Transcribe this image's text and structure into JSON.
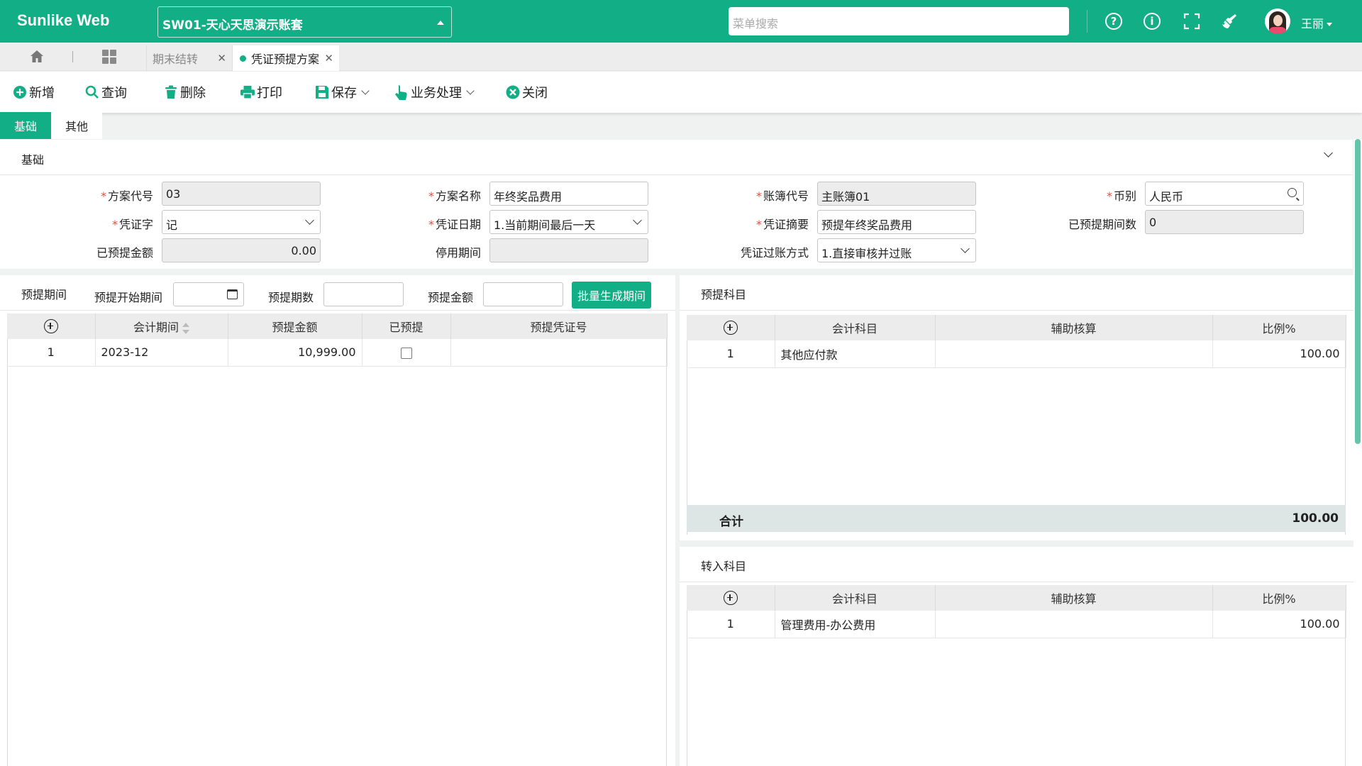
{
  "header": {
    "brand": "Sunlike Web",
    "account_select": "SW01-天心天思演示账套",
    "menu_search_placeholder": "菜单搜索",
    "user_name": "王丽",
    "icons": [
      "help-icon",
      "info-icon",
      "fullscreen-icon",
      "clean-icon"
    ],
    "accent": "#12ae86"
  },
  "tabs": [
    {
      "label": "期末结转",
      "active": false
    },
    {
      "label": "凭证预提方案",
      "active": true
    }
  ],
  "toolbar": {
    "new": "新增",
    "query": "查询",
    "delete": "删除",
    "print": "打印",
    "save": "保存",
    "business": "业务处理",
    "close": "关闭"
  },
  "subtabs": {
    "basic": "基础",
    "other": "其他"
  },
  "basic": {
    "title": "基础",
    "fields": {
      "plan_code": {
        "label": "方案代号",
        "value": "03"
      },
      "plan_name": {
        "label": "方案名称",
        "value": "年终奖品费用"
      },
      "book_code": {
        "label": "账簿代号",
        "value": "主账簿01"
      },
      "currency": {
        "label": "币别",
        "value": "人民币"
      },
      "voucher_word": {
        "label": "凭证字",
        "value": "记"
      },
      "voucher_date": {
        "label": "凭证日期",
        "value": "1.当前期间最后一天"
      },
      "voucher_summary": {
        "label": "凭证摘要",
        "value": "预提年终奖品费用"
      },
      "accrued_periods": {
        "label": "已预提期间数",
        "value": "0"
      },
      "accrued_amount": {
        "label": "已预提金额",
        "value": "0.00"
      },
      "disabled_period": {
        "label": "停用期间",
        "value": ""
      },
      "posting_method": {
        "label": "凭证过账方式",
        "value": "1.直接审核并过账"
      }
    }
  },
  "accrual": {
    "title": "预提期间",
    "start_label": "预提开始期间",
    "count_label": "预提期数",
    "amount_label": "预提金额",
    "batch_button": "批量生成期间",
    "columns": [
      "会计期间",
      "预提金额",
      "已预提",
      "预提凭证号"
    ],
    "rows": [
      {
        "no": "1",
        "period": "2023-12",
        "amount": "10,999.00",
        "accrued": false,
        "voucher": ""
      }
    ]
  },
  "accrual_accounts": {
    "title": "预提科目",
    "columns": [
      "会计科目",
      "辅助核算",
      "比例%"
    ],
    "rows": [
      {
        "no": "1",
        "account": "其他应付款",
        "aux": "",
        "ratio": "100.00"
      }
    ],
    "sum_label": "合计",
    "sum_value": "100.00"
  },
  "transfer_accounts": {
    "title": "转入科目",
    "columns": [
      "会计科目",
      "辅助核算",
      "比例%"
    ],
    "rows": [
      {
        "no": "1",
        "account": "管理费用-办公费用",
        "aux": "",
        "ratio": "100.00"
      }
    ]
  }
}
